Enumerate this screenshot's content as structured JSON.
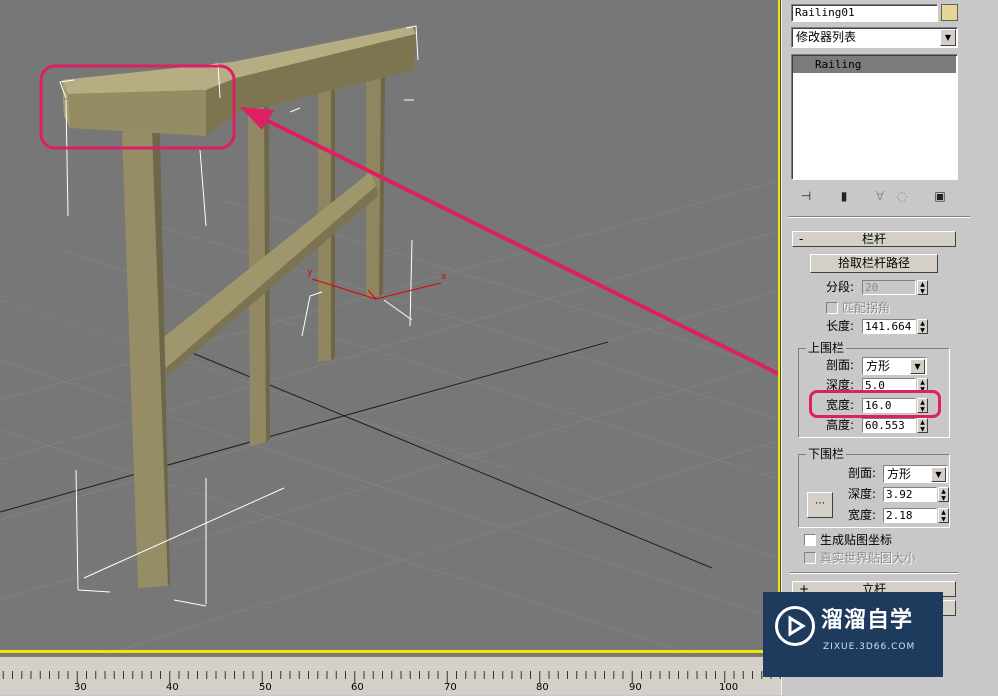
{
  "ruler": {
    "labels": [
      "30",
      "40",
      "50",
      "60",
      "70",
      "80",
      "90",
      "100"
    ]
  },
  "panel": {
    "object_name": "Railing01",
    "object_color": "#e7d694",
    "modifier_list": "修改器列表",
    "stack_item": "Railing",
    "stack_tools": [
      "pin-stack-icon",
      "show-end-result-icon",
      "make-unique-icon",
      "remove-modifier-icon",
      "configure-sets-icon"
    ],
    "railing_rollout": {
      "sign": "-",
      "title": "栏杆",
      "pick_path_button": "拾取栏杆路径",
      "segments_label": "分段:",
      "segments_value": "20",
      "respect_corners_label": "匹配拐角",
      "length_label": "长度:",
      "length_value": "141.664",
      "top_rail": {
        "group_title": "上围栏",
        "profile_label": "剖面:",
        "profile_value": "方形",
        "depth_label": "深度:",
        "depth_value": "5.0",
        "width_label": "宽度:",
        "width_value": "16.0",
        "height_label": "高度:",
        "height_value": "60.553"
      },
      "lower_rails": {
        "group_title": "下围栏",
        "profile_label": "剖面:",
        "profile_value": "方形",
        "depth_label": "深度:",
        "depth_value": "3.92",
        "width_label": "宽度:",
        "width_value": "2.18"
      },
      "gen_mapping_label": "生成贴图坐标",
      "real_world_label": "真实世界贴图大小"
    },
    "posts_rollout": {
      "sign": "+",
      "title": "立杆"
    }
  },
  "watermark": {
    "title": "溜溜自学",
    "url": "ZIXUE.3D66.COM"
  },
  "colors": {
    "viewport_bg": "#777777",
    "highlight": "#dd1f63",
    "railing": "#9b9068",
    "active_frame": "#f1e600"
  }
}
